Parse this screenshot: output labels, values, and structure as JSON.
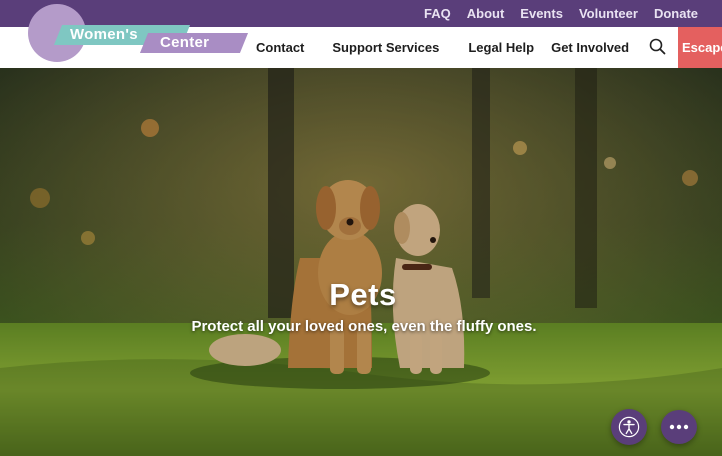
{
  "utility_nav": [
    "FAQ",
    "About",
    "Events",
    "Volunteer",
    "Donate"
  ],
  "logo": {
    "word_1": "Women's",
    "word_2": "Center"
  },
  "main_nav": [
    "Contact",
    "Support Services",
    "Legal Help",
    "Get Involved"
  ],
  "escape_label": "Escape",
  "hero": {
    "title": "Pets",
    "subtitle": "Protect all your loved ones, even the fluffy ones."
  },
  "icons": {
    "search": "search-icon",
    "accessibility": "accessibility-icon",
    "chat": "chat-icon"
  },
  "colors": {
    "brand_purple": "#5a3e7a",
    "logo_teal": "#7fc7c2",
    "logo_lavender": "#a98dc4",
    "escape_red": "#e4605f"
  }
}
